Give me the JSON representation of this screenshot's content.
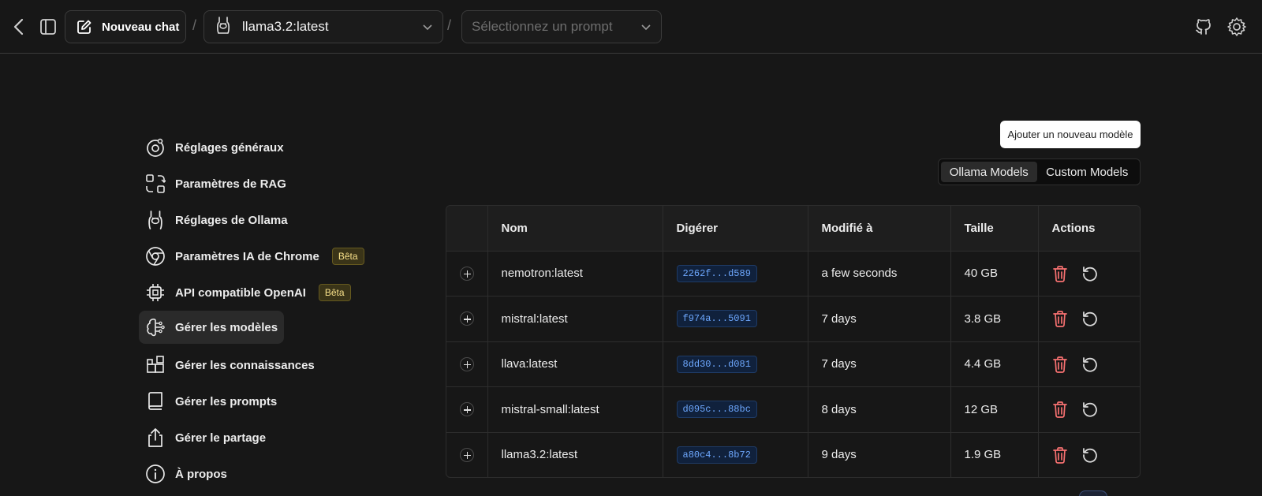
{
  "topbar": {
    "new_chat_label": "Nouveau chat",
    "model_selected": "llama3.2:latest",
    "prompt_placeholder": "Sélectionnez un prompt",
    "separator": "/"
  },
  "nav": {
    "items": [
      {
        "label": "Réglages généraux",
        "icon": "general-settings-icon"
      },
      {
        "label": "Paramètres de RAG",
        "icon": "rag-icon"
      },
      {
        "label": "Réglages de Ollama",
        "icon": "ollama-llama-icon"
      },
      {
        "label": "Paramètres IA de Chrome",
        "icon": "chrome-icon",
        "badge": "Bêta"
      },
      {
        "label": "API compatible OpenAI",
        "icon": "cpu-chip-icon",
        "badge": "Bêta"
      },
      {
        "label": "Gérer les modèles",
        "icon": "brain-icon",
        "active": true
      },
      {
        "label": "Gérer les connaissances",
        "icon": "blocks-icon"
      },
      {
        "label": "Gérer les prompts",
        "icon": "book-icon"
      },
      {
        "label": "Gérer le partage",
        "icon": "share-icon"
      },
      {
        "label": "À propos",
        "icon": "info-icon"
      }
    ]
  },
  "main": {
    "add_model_label": "Ajouter un nouveau modèle",
    "tabs": [
      {
        "label": "Ollama Models",
        "active": true
      },
      {
        "label": "Custom Models",
        "active": false
      }
    ],
    "table": {
      "columns": [
        "",
        "Nom",
        "Digérer",
        "Modifié à",
        "Taille",
        "Actions"
      ],
      "rows": [
        {
          "name": "nemotron:latest",
          "digest": "2262f...d589",
          "modified": "a few seconds",
          "size": "40 GB"
        },
        {
          "name": "mistral:latest",
          "digest": "f974a...5091",
          "modified": "7 days",
          "size": "3.8 GB"
        },
        {
          "name": "llava:latest",
          "digest": "8dd30...d081",
          "modified": "7 days",
          "size": "4.4 GB"
        },
        {
          "name": "mistral-small:latest",
          "digest": "d095c...88bc",
          "modified": "8 days",
          "size": "12 GB"
        },
        {
          "name": "llama3.2:latest",
          "digest": "a80c4...8b72",
          "modified": "9 days",
          "size": "1.9 GB"
        }
      ]
    }
  },
  "colors": {
    "background": "#171717",
    "badge_text": "#f7e08a",
    "digest_text": "#6ea8fe",
    "delete_icon": "#f87171"
  }
}
